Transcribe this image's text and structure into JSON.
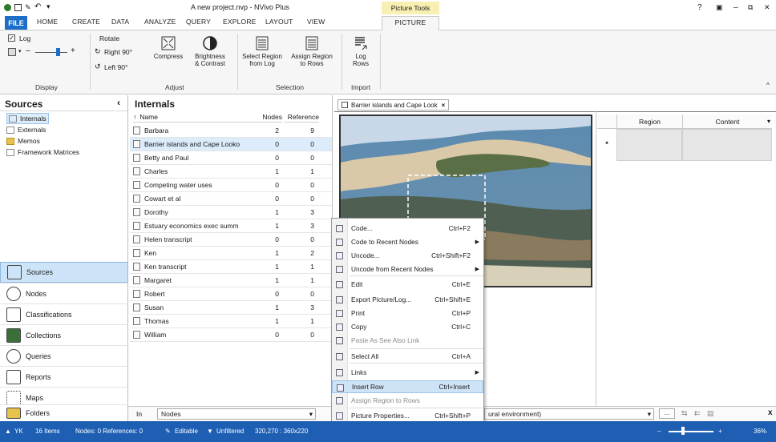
{
  "app": {
    "title": "A new project.nvp - NVivo Plus",
    "context_tab": "Picture Tools",
    "win_controls": [
      "?",
      "▣",
      "–",
      "⧉",
      "✕"
    ]
  },
  "tabs": [
    "FILE",
    "HOME",
    "CREATE",
    "DATA",
    "ANALYZE",
    "QUERY",
    "EXPLORE",
    "LAYOUT",
    "VIEW",
    "PICTURE"
  ],
  "ribbon": {
    "display": {
      "log": "Log",
      "label": "Display"
    },
    "rotate": {
      "title": "Rotate",
      "right": "Right 90°",
      "left": "Left 90°"
    },
    "adjust": {
      "compress": "Compress",
      "brightness": "Brightness",
      "contrast": "& Contrast",
      "label": "Adjust"
    },
    "selection": {
      "select_region_1": "Select Region",
      "select_region_2": "from Log",
      "assign_region_1": "Assign Region",
      "assign_region_2": "to Rows",
      "label": "Selection"
    },
    "import": {
      "log": "Log",
      "rows": "Rows",
      "label": "Import"
    }
  },
  "sources": {
    "title": "Sources",
    "items": [
      "Internals",
      "Externals",
      "Memos",
      "Framework Matrices"
    ]
  },
  "nav": [
    "Sources",
    "Nodes",
    "Classifications",
    "Collections",
    "Queries",
    "Reports",
    "Maps",
    "Folders"
  ],
  "list": {
    "title": "Internals",
    "col_name": "Name",
    "col_nodes": "Nodes",
    "col_refs": "Reference",
    "rows": [
      {
        "name": "Barbara",
        "nodes": "2",
        "refs": "9"
      },
      {
        "name": "Barrier islands and Cape Looko",
        "nodes": "0",
        "refs": "0"
      },
      {
        "name": "Betty and Paul",
        "nodes": "0",
        "refs": "0"
      },
      {
        "name": "Charles",
        "nodes": "1",
        "refs": "1"
      },
      {
        "name": "Competing water uses",
        "nodes": "0",
        "refs": "0"
      },
      {
        "name": "Cowart et al",
        "nodes": "0",
        "refs": "0"
      },
      {
        "name": "Dorothy",
        "nodes": "1",
        "refs": "3"
      },
      {
        "name": "Estuary economics exec summ",
        "nodes": "1",
        "refs": "3"
      },
      {
        "name": "Helen transcript",
        "nodes": "0",
        "refs": "0"
      },
      {
        "name": "Ken",
        "nodes": "1",
        "refs": "2"
      },
      {
        "name": "Ken transcript",
        "nodes": "1",
        "refs": "1"
      },
      {
        "name": "Margaret",
        "nodes": "1",
        "refs": "1"
      },
      {
        "name": "Robert",
        "nodes": "0",
        "refs": "0"
      },
      {
        "name": "Susan",
        "nodes": "1",
        "refs": "3"
      },
      {
        "name": "Thomas",
        "nodes": "1",
        "refs": "1"
      },
      {
        "name": "William",
        "nodes": "0",
        "refs": "0"
      }
    ]
  },
  "detail": {
    "tab": "Barrier islands and Cape Look",
    "col_region": "Region",
    "col_content": "Content",
    "new_row": "*"
  },
  "menu": [
    {
      "label": "Code...",
      "shortcut": "Ctrl+F2",
      "sub": false
    },
    {
      "label": "Code to Recent Nodes",
      "shortcut": "",
      "sub": true
    },
    {
      "label": "Uncode...",
      "shortcut": "Ctrl+Shift+F2",
      "sub": false
    },
    {
      "label": "Uncode from Recent Nodes",
      "shortcut": "",
      "sub": true
    },
    {
      "label": "Edit",
      "shortcut": "Ctrl+E",
      "sub": false
    },
    {
      "label": "Export Picture/Log...",
      "shortcut": "Ctrl+Shift+E",
      "sub": false
    },
    {
      "label": "Print",
      "shortcut": "Ctrl+P",
      "sub": false
    },
    {
      "label": "Copy",
      "shortcut": "Ctrl+C",
      "sub": false
    },
    {
      "label": "Paste As See Also Link",
      "shortcut": "",
      "sub": false
    },
    {
      "label": "Select All",
      "shortcut": "Ctrl+A",
      "sub": false
    },
    {
      "label": "Links",
      "shortcut": "",
      "sub": true
    },
    {
      "label": "Insert Row",
      "shortcut": "Ctrl+Insert",
      "sub": false
    },
    {
      "label": "Assign Region to Rows",
      "shortcut": "",
      "sub": false
    },
    {
      "label": "Picture Properties...",
      "shortcut": "Ctrl+Shift+P",
      "sub": false
    }
  ],
  "bottom": {
    "in_label": "In",
    "in_value": "Nodes",
    "node_value": "ural environment)"
  },
  "status": {
    "user": "YK",
    "items": "16 Items",
    "nodes": "Nodes: 0 References: 0",
    "editable": "Editable",
    "filter": "Unfiltered",
    "coords": "320,270 : 360x220",
    "zoom": "36%"
  },
  "colors": {
    "accent": "#1d6ec9",
    "status_bg": "#1e5fb4",
    "menu_highlight": "#cfe3f7",
    "selection_row": "#dcecfb"
  }
}
